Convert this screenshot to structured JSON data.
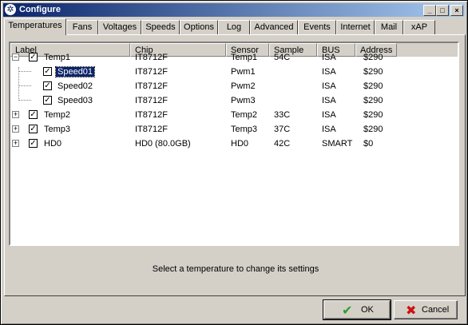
{
  "window": {
    "title": "Configure",
    "controls": {
      "minimize": "_",
      "maximize": "□",
      "close": "×"
    }
  },
  "tabs": [
    {
      "label": "Temperatures",
      "active": true
    },
    {
      "label": "Fans"
    },
    {
      "label": "Voltages"
    },
    {
      "label": "Speeds"
    },
    {
      "label": "Options"
    },
    {
      "label": "Log"
    },
    {
      "label": "Advanced"
    },
    {
      "label": "Events"
    },
    {
      "label": "Internet"
    },
    {
      "label": "Mail"
    },
    {
      "label": "xAP"
    }
  ],
  "table": {
    "columns": [
      "Label",
      "Chip",
      "Sensor",
      "Sample",
      "BUS",
      "Address"
    ],
    "rows": [
      {
        "label": "Temp1",
        "chip": "IT8712F",
        "sensor": "Temp1",
        "sample": "54C",
        "bus": "ISA",
        "address": "$290",
        "checked": "✓",
        "expander": "−"
      },
      {
        "label": "Speed01",
        "chip": "IT8712F",
        "sensor": "Pwm1",
        "sample": "",
        "bus": "ISA",
        "address": "$290",
        "checked": "✓",
        "selected": true
      },
      {
        "label": "Speed02",
        "chip": "IT8712F",
        "sensor": "Pwm2",
        "sample": "",
        "bus": "ISA",
        "address": "$290",
        "checked": "✓"
      },
      {
        "label": "Speed03",
        "chip": "IT8712F",
        "sensor": "Pwm3",
        "sample": "",
        "bus": "ISA",
        "address": "$290",
        "checked": "✓"
      },
      {
        "label": "Temp2",
        "chip": "IT8712F",
        "sensor": "Temp2",
        "sample": "33C",
        "bus": "ISA",
        "address": "$290",
        "checked": "✓",
        "expander": "+"
      },
      {
        "label": "Temp3",
        "chip": "IT8712F",
        "sensor": "Temp3",
        "sample": "37C",
        "bus": "ISA",
        "address": "$290",
        "checked": "✓",
        "expander": "+"
      },
      {
        "label": "HD0",
        "chip": "HD0 (80.0GB)",
        "sensor": "HD0",
        "sample": "42C",
        "bus": "SMART",
        "address": "$0",
        "checked": "✓",
        "expander": "+"
      }
    ]
  },
  "status": "Select a temperature to change its settings",
  "buttons": {
    "ok": {
      "label": "OK",
      "icon": "✔",
      "color": "#2e9e2e"
    },
    "cancel": {
      "label": "Cancel",
      "icon": "✖",
      "color": "#cc1111"
    }
  }
}
